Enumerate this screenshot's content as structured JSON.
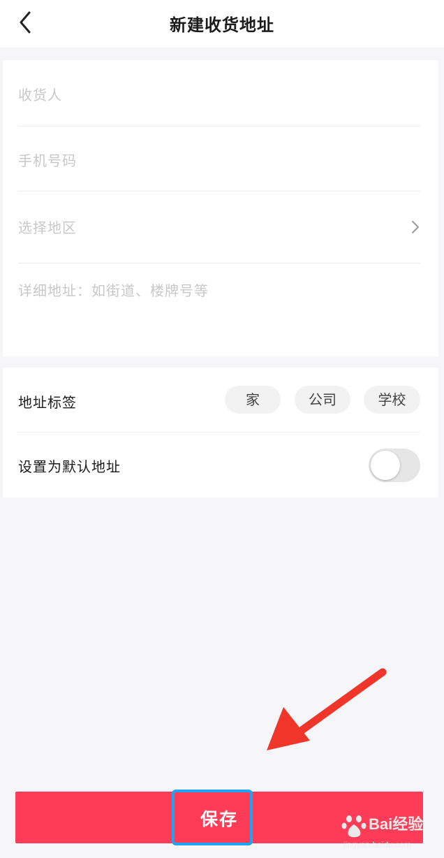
{
  "header": {
    "title": "新建收货地址",
    "back_icon": "chevron-left-icon"
  },
  "form": {
    "recipient_placeholder": "收货人",
    "phone_placeholder": "手机号码",
    "region_placeholder": "选择地区",
    "detail_placeholder": "详细地址：如街道、楼牌号等"
  },
  "options": {
    "tag_label": "地址标签",
    "tags": [
      "家",
      "公司",
      "学校"
    ],
    "default_label": "设置为默认地址",
    "default_enabled": false
  },
  "actions": {
    "save_label": "保存"
  },
  "watermark": {
    "brand": "Bai经验",
    "url": "jingyan.baidu.com"
  },
  "colors": {
    "accent": "#fe3c58",
    "highlight": "#1fa4f2",
    "annotation_arrow": "#f0362a",
    "placeholder": "#c8c8c8",
    "background": "#f6f6f8"
  }
}
